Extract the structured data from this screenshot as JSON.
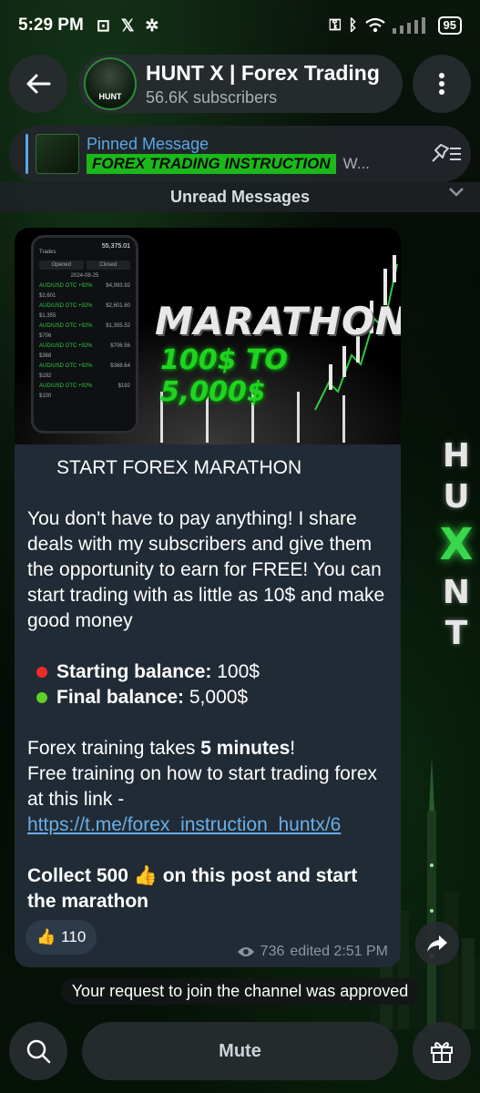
{
  "status_bar": {
    "time": "5:29 PM",
    "battery": "95",
    "icons": [
      "notification-icon",
      "x-app-icon",
      "settings-icon",
      "key-icon",
      "bluetooth-icon",
      "wifi-icon",
      "signal-icon"
    ]
  },
  "header": {
    "channel_name": "HUNT X | Forex Trading",
    "subscribers": "56.6K subscribers",
    "avatar_text": "HUNT"
  },
  "pinned": {
    "label": "Pinned Message",
    "preview_banner": "FOREX TRADING INSTRUCTION",
    "preview_more": "W..."
  },
  "unread_label": "Unread Messages",
  "background": {
    "letters": [
      "H",
      "U",
      "X",
      "N",
      "T"
    ]
  },
  "message": {
    "image": {
      "title": "MARATHON",
      "subtitle": "100$ TO 5,000$",
      "phone": {
        "balance": "55,375.01",
        "header": "Trades",
        "tab_open": "Opened",
        "tab_closed": "Closed",
        "date": "2024-08-25",
        "rows": [
          {
            "pair": "AUD/USD OTC +92%",
            "amount": "$2,601",
            "value": "$4,993.92"
          },
          {
            "pair": "AUD/USD OTC +92%",
            "amount": "$1,355",
            "value": "$2,601.60"
          },
          {
            "pair": "AUD/USD OTC +92%",
            "amount": "$706",
            "value": "$1,355.52"
          },
          {
            "pair": "AUD/USD OTC +92%",
            "amount": "$368",
            "value": "$706.56"
          },
          {
            "pair": "AUD/USD OTC +92%",
            "amount": "$192",
            "value": "$368.64"
          },
          {
            "pair": "AUD/USD OTC +92%",
            "amount": "$100",
            "value": "$192"
          }
        ]
      }
    },
    "heading": "START FOREX MARATHON",
    "paragraph1": "You don't have to pay anything! I share deals with my subscribers and give them the opportunity to earn for FREE! You can start trading with as little as 10$ and make good money",
    "start_label": "Starting balance:",
    "start_value": " 100$",
    "final_label": "Final balance:",
    "final_value": " 5,000$",
    "training_pre": "Forex training takes ",
    "training_bold": "5 minutes",
    "training_post": "!",
    "training_line2": "Free training on how to start trading forex at this link - ",
    "link": "https://t.me/forex_instruction_huntx/6",
    "collect_pre": "Collect 500 ",
    "collect_emoji": "👍",
    "collect_post": " on this post and start the marathon",
    "reaction_emoji": "👍",
    "reaction_count": "110",
    "views": "736",
    "edited": "edited 2:51 PM"
  },
  "service_message": "Your request to join the channel was approved",
  "bottom": {
    "mute_label": "Mute"
  }
}
